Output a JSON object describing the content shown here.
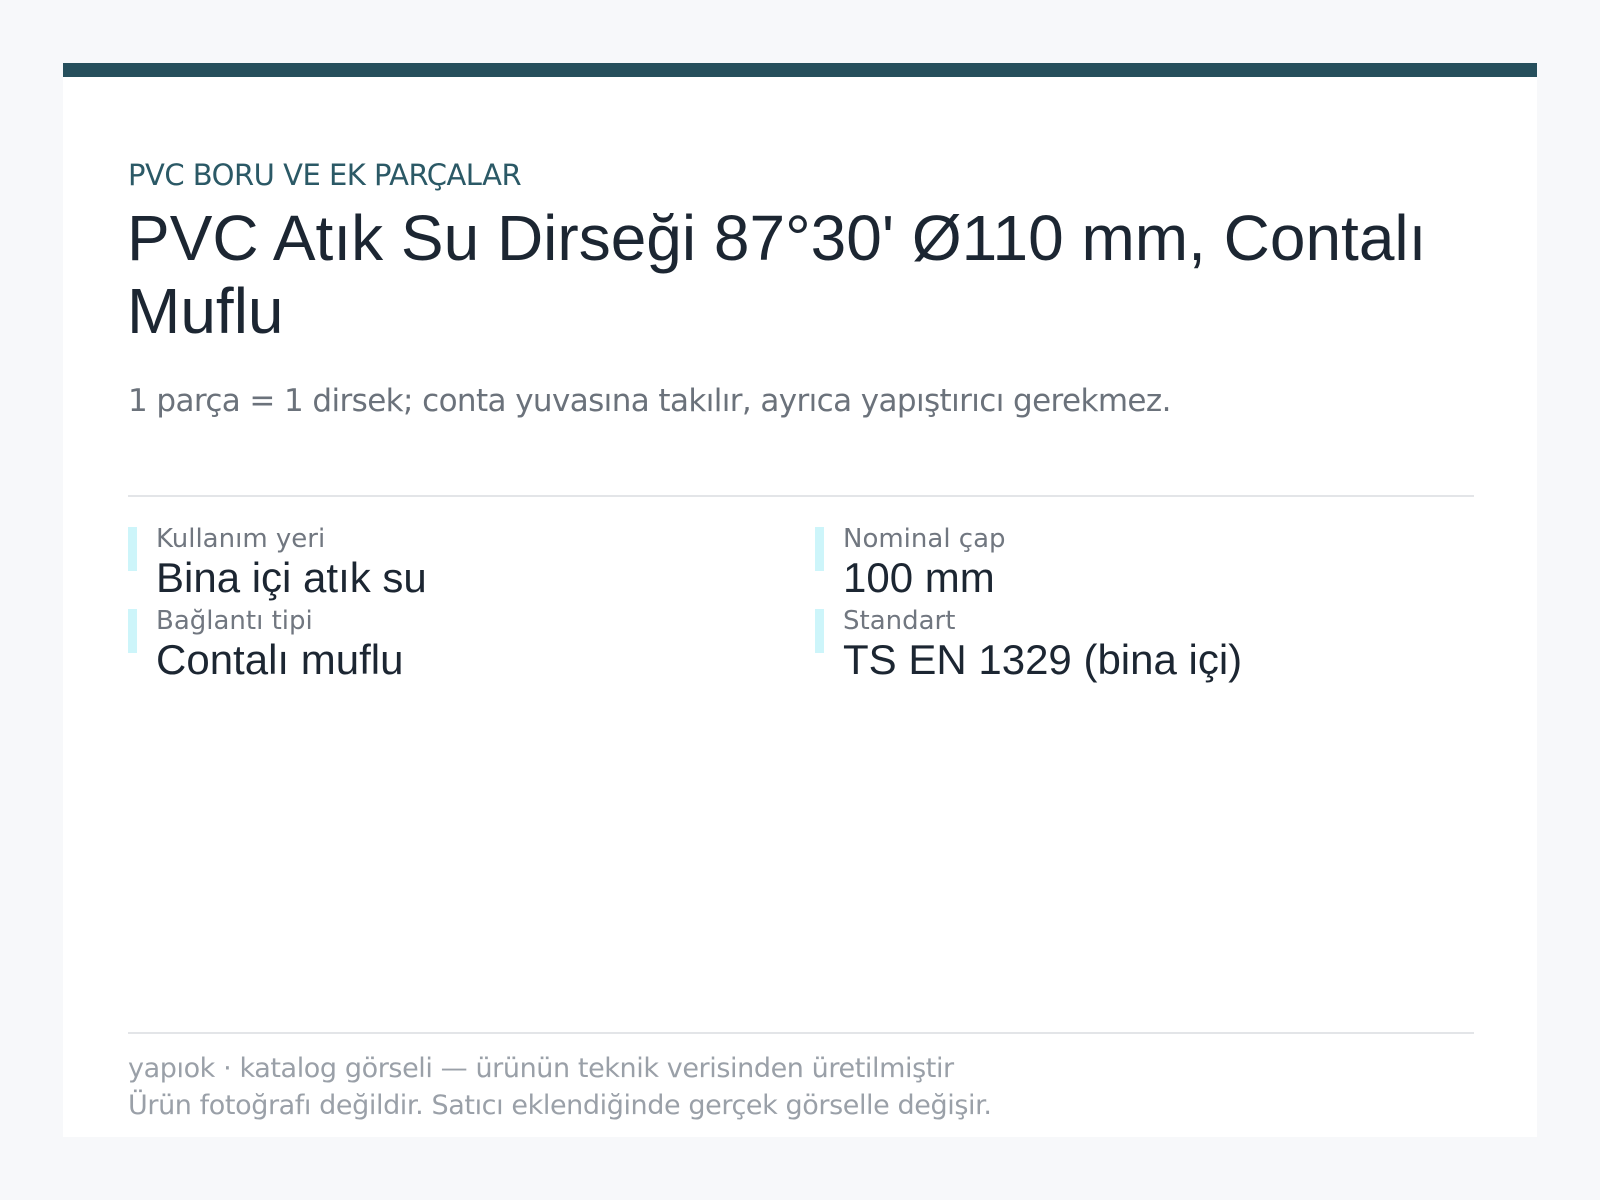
{
  "product": {
    "category": "PVC BORU VE EK PARÇALAR",
    "title": "PVC Atık Su Dirseği 87°30' Ø110 mm, Contalı Muflu",
    "subtitle": "1 parça = 1 dirsek; conta yuvasına takılır, ayrıca yapıştırıcı gerekmez."
  },
  "specs": [
    {
      "label": "Kullanım yeri",
      "value": "Bina içi atık su"
    },
    {
      "label": "Nominal çap",
      "value": "100 mm"
    },
    {
      "label": "Bağlantı tipi",
      "value": "Contalı muflu"
    },
    {
      "label": "Standart",
      "value": "TS EN 1329 (bina içi)"
    }
  ],
  "footer": {
    "line1": "yapıok · katalog görseli — ürünün teknik verisinden üretilmiştir",
    "line2": "Ürün fotoğrafı değildir. Satıcı eklendiğinde gerçek görselle değişir."
  },
  "colors": {
    "accent_bar": "#264f5c",
    "spec_accent": "#cdf5fa",
    "category_text": "#2b5966",
    "title_text": "#1c2632"
  }
}
